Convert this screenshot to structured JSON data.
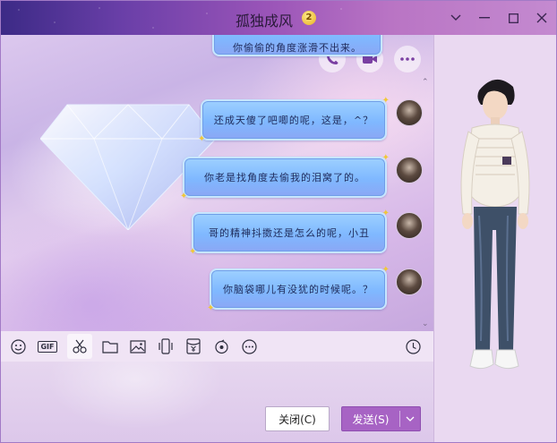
{
  "window": {
    "title": "孤独成风",
    "badge": "2",
    "controls": [
      "chevron-down-icon",
      "minimize-icon",
      "maximize-icon",
      "close-icon"
    ]
  },
  "chat": {
    "actions": [
      "phone-icon",
      "video-icon",
      "more-icon"
    ],
    "messages": [
      {
        "text": "你偷偷的角度涨滑不出来。",
        "partial": true
      },
      {
        "text": "还成天傻了吧唧的呢，这是，^？"
      },
      {
        "text": "你老是找角度去偷我的泪窝了的。"
      },
      {
        "text": "哥的精神抖擞还是怎么的呢，小丑"
      },
      {
        "text": "你脑袋哪儿有没犹的时候呢。？"
      }
    ]
  },
  "toolbar": {
    "tools": [
      "emoji-icon",
      "gif-icon",
      "screenshot-icon",
      "folder-icon",
      "image-icon",
      "shake-icon",
      "red-packet-icon",
      "music-icon",
      "more-tools-icon"
    ],
    "gif_label": "GIF",
    "history": "history-icon"
  },
  "footer": {
    "close_label": "关闭(C)",
    "send_label": "发送(S)"
  },
  "colors": {
    "accent": "#a763c4",
    "bubble": "#8ab8ff"
  }
}
